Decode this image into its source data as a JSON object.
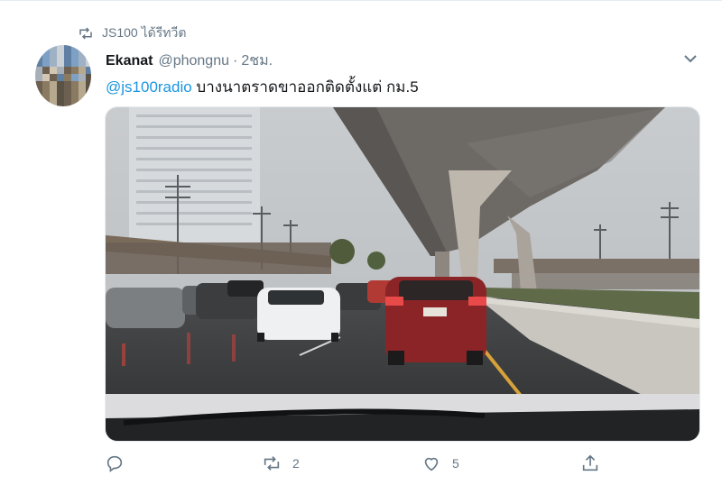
{
  "retweet_context": {
    "icon": "retweet-icon",
    "label": "JS100 ได้รีทวีต"
  },
  "tweet": {
    "author_name": "Ekanat",
    "author_handle": "@phongnu",
    "separator": "·",
    "time": "2ชม.",
    "mention": "@js100radio",
    "body": " บางนาตราดขาออกติดตั้งแต่ กม.5",
    "photo_description_icon": "traffic-photo"
  },
  "actions": {
    "reply": {
      "icon": "reply-icon",
      "count": ""
    },
    "retweet": {
      "icon": "retweet-icon",
      "count": "2"
    },
    "like": {
      "icon": "heart-icon",
      "count": "5"
    },
    "share": {
      "icon": "share-icon"
    }
  },
  "colors": {
    "accent": "#1b95e0",
    "muted": "#657786",
    "text": "#14171a"
  }
}
